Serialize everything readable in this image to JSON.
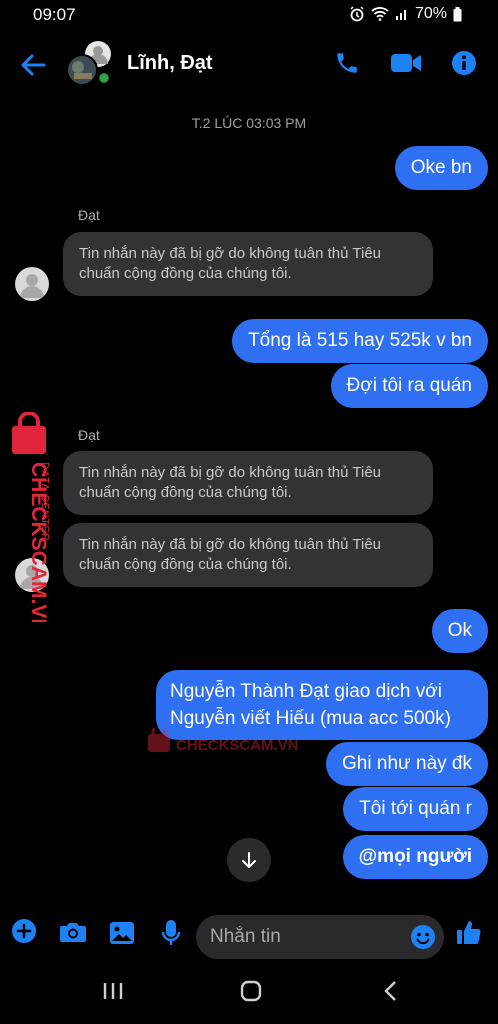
{
  "status_bar": {
    "time": "09:07",
    "battery": "70%",
    "icons": [
      "alarm-icon",
      "wifi-icon",
      "signal-icon",
      "battery-icon"
    ]
  },
  "header": {
    "title": "Lĩnh, Đạt",
    "icons": [
      "back-arrow-icon",
      "phone-icon",
      "video-camera-icon",
      "info-icon"
    ],
    "accent_color": "#1e82f6",
    "online_color": "#31a24c"
  },
  "conversation": {
    "timestamp": "T.2 LÚC 03:03 PM",
    "removed_text": "Tin nhắn này đã bị gỡ do không tuân thủ Tiêu chuẩn cộng đồng của chúng tôi.",
    "sender_name": "Đạt",
    "msg_oke": "Oke bn",
    "msg_tong": "Tổng là 515 hay 525k v bn",
    "msg_doi": "Đợi tôi ra quán",
    "msg_ok": "Ok",
    "msg_long": "Nguyễn Thành Đạt giao dịch với Nguyễn viết Hiếu (mua acc 500k)",
    "msg_ghi": "Ghi như này đk",
    "msg_toi": "Tôi tới quán r",
    "msg_mention": "@mọi người",
    "bubble_color": "#2f6ff2",
    "other_bubble_color": "#333336"
  },
  "watermark": {
    "brand": "CHECKSCAM.VN",
    "sub": "DATA CENTER",
    "color": "#e0263a"
  },
  "composer": {
    "placeholder": "Nhắn tin",
    "icons": [
      "plus-icon",
      "camera-icon",
      "image-icon",
      "microphone-icon",
      "emoji-icon",
      "thumbs-up-icon"
    ]
  }
}
